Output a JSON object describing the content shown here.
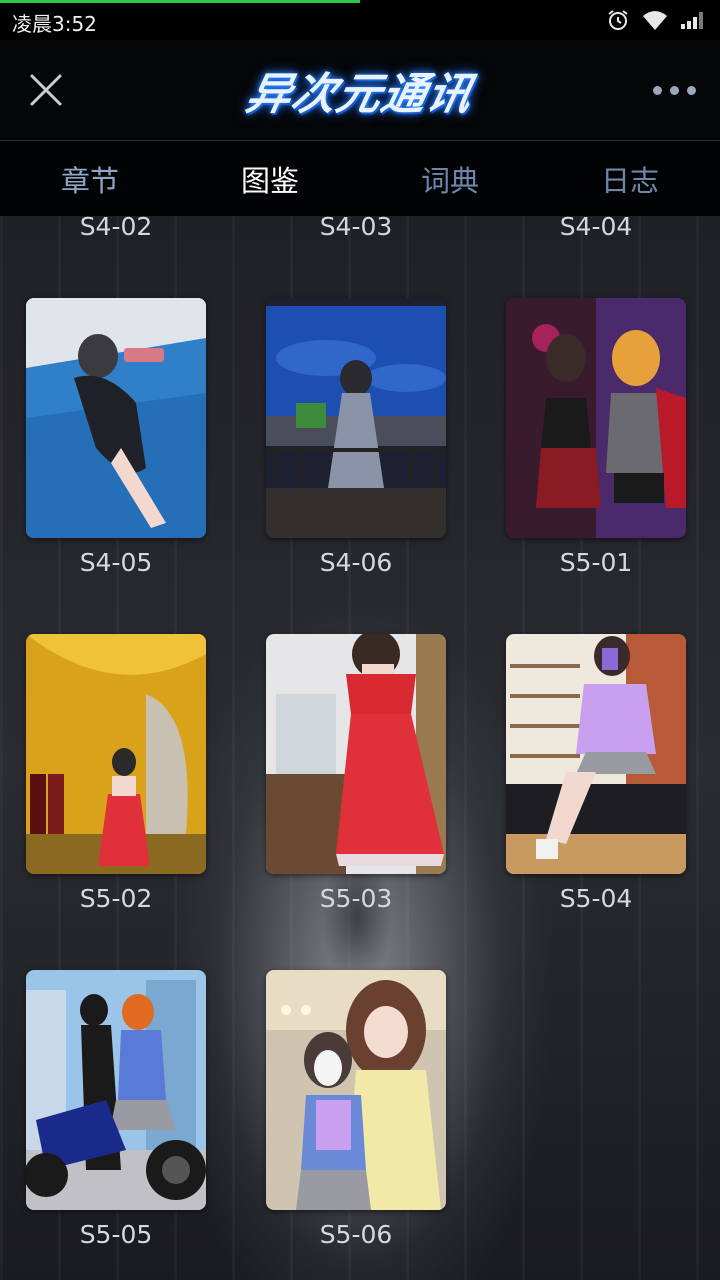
{
  "status_bar": {
    "time": "凌晨3:52",
    "load_progress": 0.5
  },
  "header": {
    "logo_text": "异次元通讯",
    "close_icon": "close-icon",
    "more_icon": "more-dots-icon"
  },
  "tabs": [
    {
      "label": "章节",
      "color": "#8fa6c6",
      "active": false
    },
    {
      "label": "图鉴",
      "color": "#ffffff",
      "active": true
    },
    {
      "label": "词典",
      "color": "#6f86aa",
      "active": false
    },
    {
      "label": "日志",
      "color": "#6f86aa",
      "active": false
    }
  ],
  "gallery": {
    "partial_row": [
      "S4-02",
      "S4-03",
      "S4-04"
    ],
    "items": [
      {
        "label": "S4-05",
        "art": "pool"
      },
      {
        "label": "S4-06",
        "art": "balcony"
      },
      {
        "label": "S5-01",
        "art": "duo-night"
      },
      {
        "label": "S5-02",
        "art": "yellow-hall"
      },
      {
        "label": "S5-03",
        "art": "red-dress"
      },
      {
        "label": "S5-04",
        "art": "shoe-store"
      },
      {
        "label": "S5-05",
        "art": "motorbike"
      },
      {
        "label": "S5-06",
        "art": "mask-selfie"
      }
    ]
  }
}
